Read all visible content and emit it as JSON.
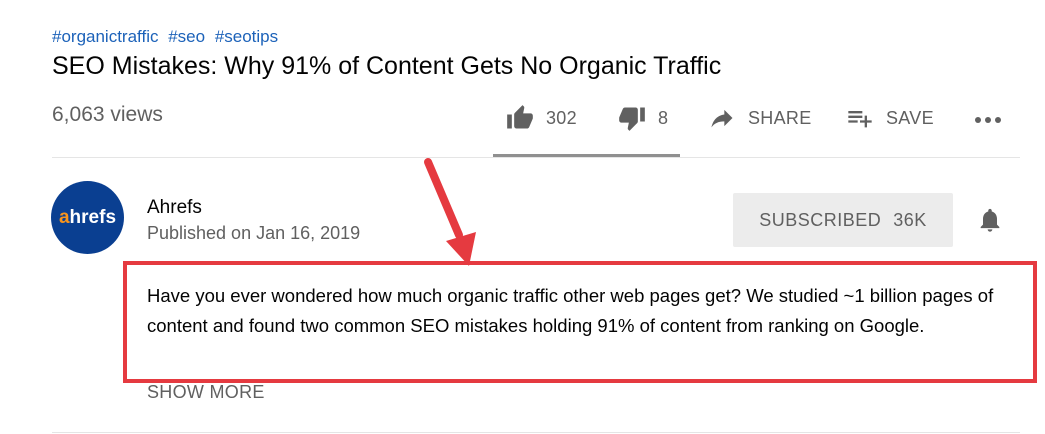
{
  "hashtags": [
    "#organictraffic",
    "#seo",
    "#seotips"
  ],
  "video": {
    "title": "SEO Mistakes: Why 91% of Content Gets No Organic Traffic",
    "views": "6,063 views",
    "likes": "302",
    "dislikes": "8",
    "share_label": "SHARE",
    "save_label": "SAVE",
    "like_ratio": 0.974
  },
  "channel": {
    "avatar_letter_accent": "a",
    "avatar_text_rest": "hrefs",
    "name": "Ahrefs",
    "published": "Published on Jan 16, 2019",
    "subscribe_label": "SUBSCRIBED",
    "subscriber_count": "36K"
  },
  "description": {
    "text": "Have you ever wondered how much organic traffic other web pages get? We studied ~1 billion pages of content and found two common SEO mistakes holding 91% of content from ranking on Google.",
    "show_more_label": "SHOW MORE"
  },
  "annotation": {
    "color": "#e53a40"
  },
  "icons": [
    "thumbs-up-icon",
    "thumbs-down-icon",
    "share-icon",
    "playlist-add-icon",
    "more-icon",
    "bell-icon"
  ]
}
